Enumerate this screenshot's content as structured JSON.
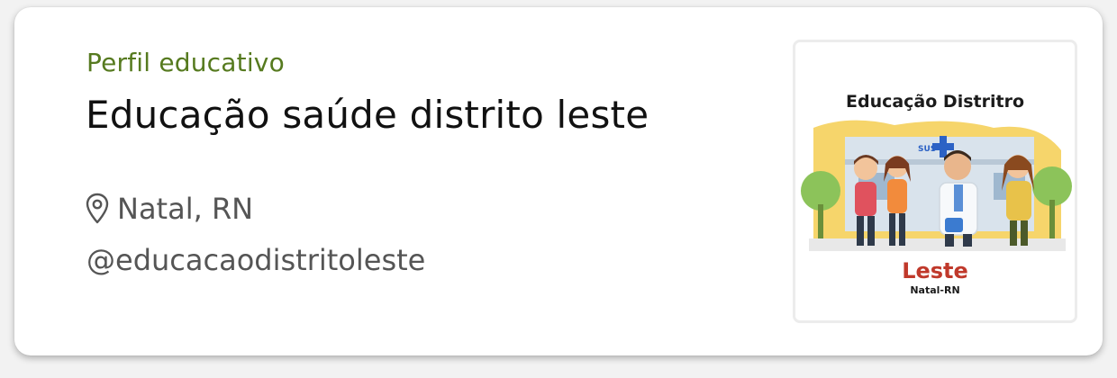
{
  "profile": {
    "category": "Perfil educativo",
    "name": "Educação saúde distrito leste",
    "location": "Natal, RN",
    "handle": "@educacaodistritoleste"
  },
  "image": {
    "title": "Educação Distritro",
    "sign": "SUS",
    "bottom_word": "Leste",
    "bottom_small": "Natal-RN"
  },
  "icons": {
    "location": "map-pin-icon"
  },
  "colors": {
    "category_text": "#567a1f",
    "title_text": "#111111",
    "secondary_text": "#555555",
    "leste_red": "#c0392b"
  }
}
